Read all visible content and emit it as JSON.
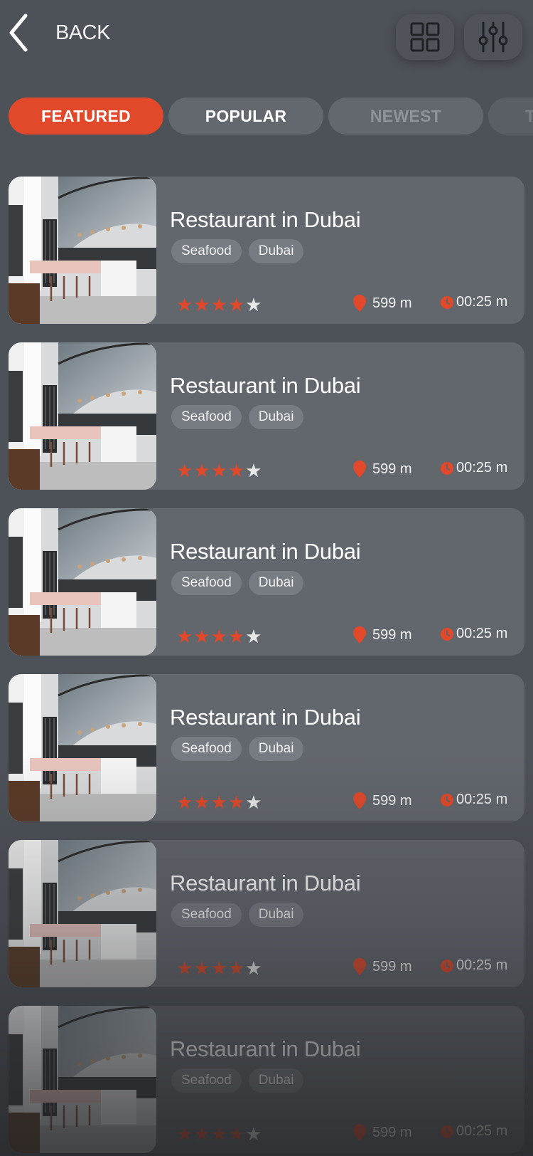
{
  "header": {
    "back_label": "BACK",
    "icons": [
      "back-chevron-icon",
      "grid-view-icon",
      "filter-sliders-icon"
    ]
  },
  "tabs": [
    {
      "label": "FEATURED",
      "active": true
    },
    {
      "label": "POPULAR",
      "active": false
    },
    {
      "label": "NEWEST",
      "active": false
    },
    {
      "label": "T",
      "active": false
    }
  ],
  "colors": {
    "accent": "#e1492a",
    "background": "#4d5158",
    "card": "#62666d"
  },
  "restaurants": [
    {
      "title": "Restaurant in Dubai",
      "tags": [
        "Seafood",
        "Dubai"
      ],
      "rating": 4,
      "max_rating": 5,
      "distance": "599 m",
      "time": "00:25 m"
    },
    {
      "title": "Restaurant in Dubai",
      "tags": [
        "Seafood",
        "Dubai"
      ],
      "rating": 4,
      "max_rating": 5,
      "distance": "599 m",
      "time": "00:25 m"
    },
    {
      "title": "Restaurant in Dubai",
      "tags": [
        "Seafood",
        "Dubai"
      ],
      "rating": 4,
      "max_rating": 5,
      "distance": "599 m",
      "time": "00:25 m"
    },
    {
      "title": "Restaurant in Dubai",
      "tags": [
        "Seafood",
        "Dubai"
      ],
      "rating": 4,
      "max_rating": 5,
      "distance": "599 m",
      "time": "00:25 m"
    },
    {
      "title": "Restaurant in Dubai",
      "tags": [
        "Seafood",
        "Dubai"
      ],
      "rating": 4,
      "max_rating": 5,
      "distance": "599 m",
      "time": "00:25 m"
    },
    {
      "title": "Restaurant in Dubai",
      "tags": [
        "Seafood",
        "Dubai"
      ],
      "rating": 4,
      "max_rating": 5,
      "distance": "599 m",
      "time": "00:25 m"
    }
  ]
}
